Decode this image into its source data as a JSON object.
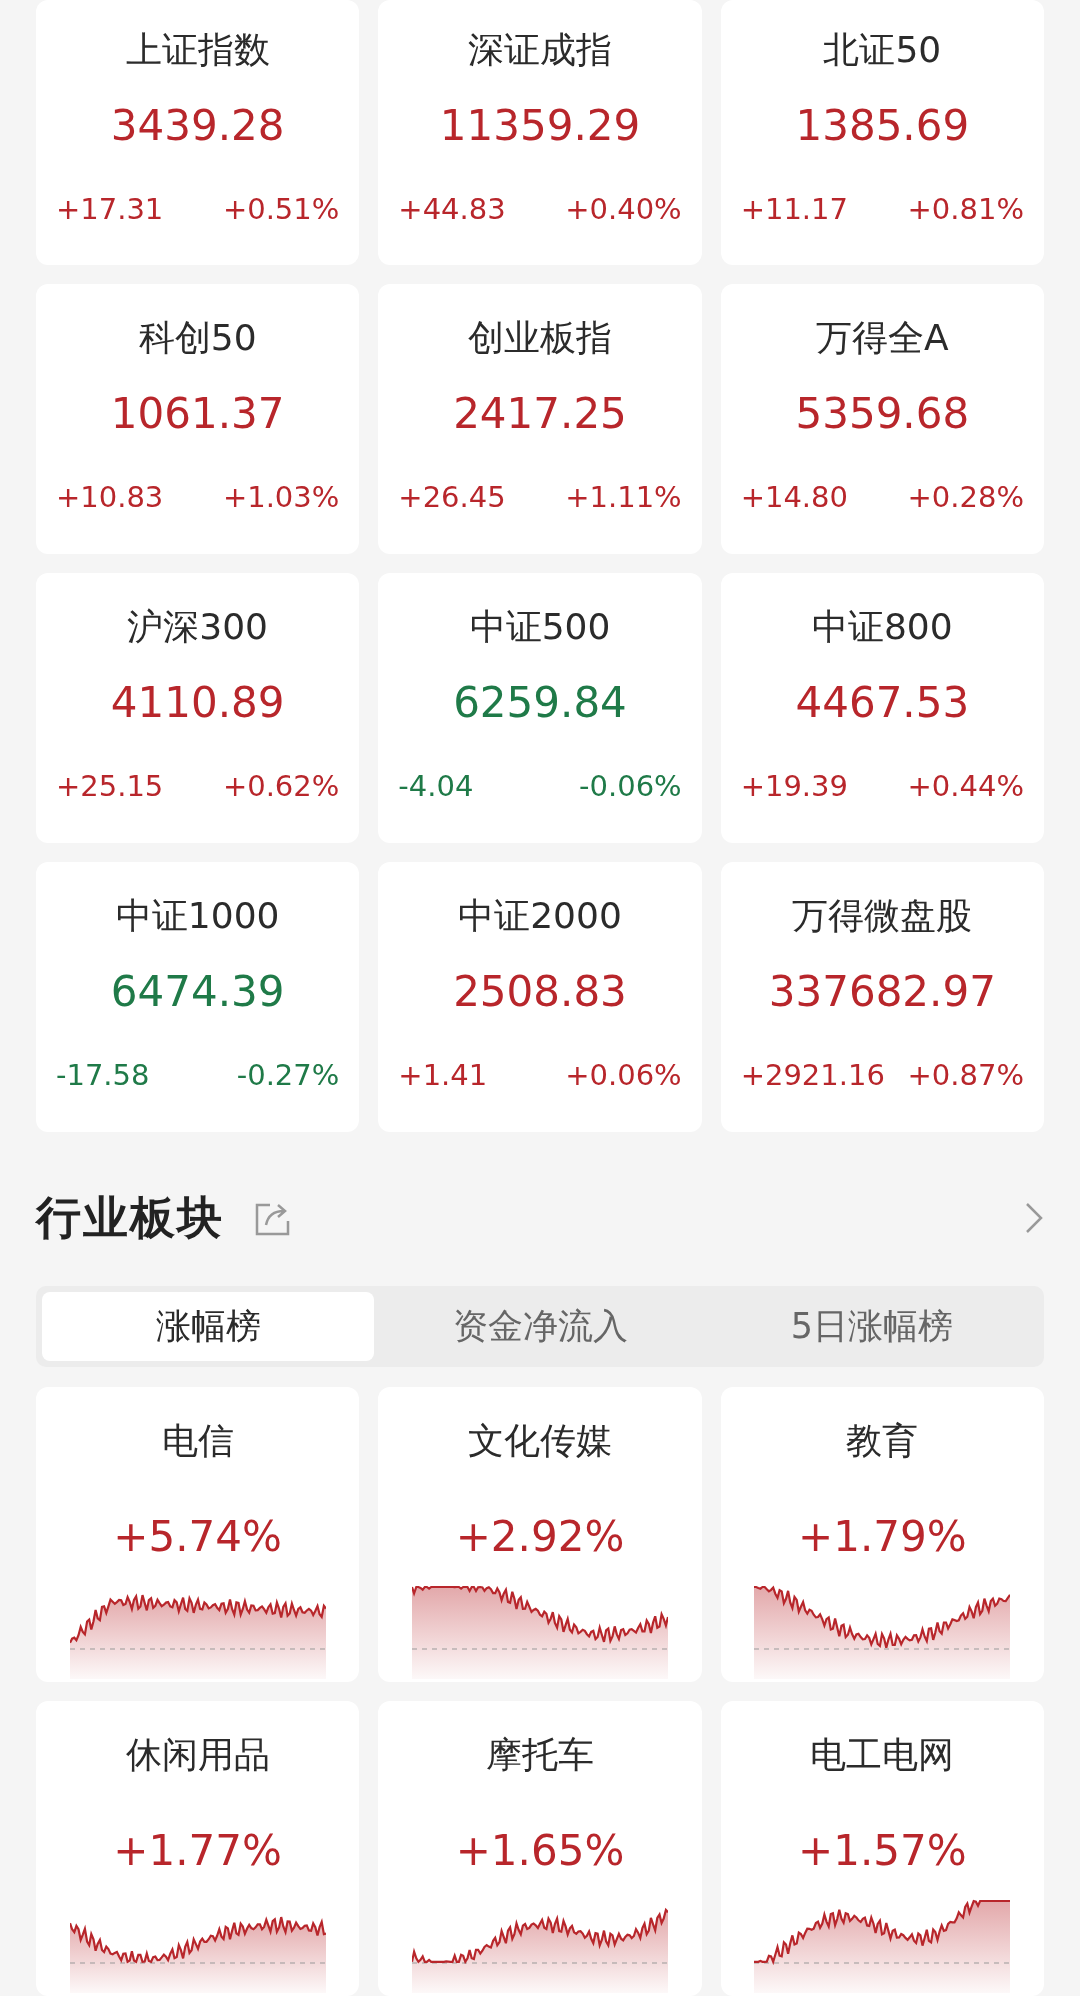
{
  "indices": [
    {
      "name": "上证指数",
      "value": "3439.28",
      "change": "+17.31",
      "percent": "+0.51%",
      "color": "#b8262b"
    },
    {
      "name": "深证成指",
      "value": "11359.29",
      "change": "+44.83",
      "percent": "+0.40%",
      "color": "#b8262b"
    },
    {
      "name": "北证50",
      "value": "1385.69",
      "change": "+11.17",
      "percent": "+0.81%",
      "color": "#b8262b"
    },
    {
      "name": "科创50",
      "value": "1061.37",
      "change": "+10.83",
      "percent": "+1.03%",
      "color": "#b8262b"
    },
    {
      "name": "创业板指",
      "value": "2417.25",
      "change": "+26.45",
      "percent": "+1.11%",
      "color": "#b8262b"
    },
    {
      "name": "万得全A",
      "value": "5359.68",
      "change": "+14.80",
      "percent": "+0.28%",
      "color": "#b8262b"
    },
    {
      "name": "沪深300",
      "value": "4110.89",
      "change": "+25.15",
      "percent": "+0.62%",
      "color": "#b8262b"
    },
    {
      "name": "中证500",
      "value": "6259.84",
      "change": "-4.04",
      "percent": "-0.06%",
      "color": "#1f7a48"
    },
    {
      "name": "中证800",
      "value": "4467.53",
      "change": "+19.39",
      "percent": "+0.44%",
      "color": "#b8262b"
    },
    {
      "name": "中证1000",
      "value": "6474.39",
      "change": "-17.58",
      "percent": "-0.27%",
      "color": "#1f7a48"
    },
    {
      "name": "中证2000",
      "value": "2508.83",
      "change": "+1.41",
      "percent": "+0.06%",
      "color": "#b8262b"
    },
    {
      "name": "万得微盘股",
      "value": "337682.97",
      "change": "+2921.16",
      "percent": "+0.87%",
      "color": "#b8262b"
    }
  ],
  "section": {
    "title": "行业板块"
  },
  "tabs": [
    {
      "label": "涨幅榜",
      "selected": true
    },
    {
      "label": "资金净流入",
      "selected": false
    },
    {
      "label": "5日涨幅榜",
      "selected": false
    }
  ],
  "sectors": [
    {
      "name": "电信",
      "percent": "+5.74%",
      "color": "#b8262b"
    },
    {
      "name": "文化传媒",
      "percent": "+2.92%",
      "color": "#b8262b"
    },
    {
      "name": "教育",
      "percent": "+1.79%",
      "color": "#b8262b"
    },
    {
      "name": "休闲用品",
      "percent": "+1.77%",
      "color": "#b8262b"
    },
    {
      "name": "摩托车",
      "percent": "+1.65%",
      "color": "#b8262b"
    },
    {
      "name": "电工电网",
      "percent": "+1.57%",
      "color": "#b8262b"
    }
  ]
}
